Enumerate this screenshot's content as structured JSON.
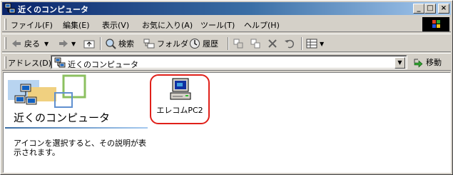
{
  "window": {
    "title": "近くのコンピュータ",
    "icon": "network-neighborhood-icon",
    "controls": {
      "minimize": "_",
      "maximize": "□",
      "close": "×"
    }
  },
  "menubar": {
    "items": [
      {
        "label": "ファイル(F)"
      },
      {
        "label": "編集(E)"
      },
      {
        "label": "表示(V)"
      },
      {
        "label": "お気に入り(A)"
      },
      {
        "label": "ツール(T)"
      },
      {
        "label": "ヘルプ(H)"
      }
    ]
  },
  "toolbar": {
    "back_label": "戻る",
    "search_label": "検索",
    "folders_label": "フォルダ",
    "history_label": "履歴"
  },
  "addressbar": {
    "label": "アドレス(D)",
    "value": "近くのコンピュータ",
    "go_label": "移動"
  },
  "content": {
    "view_title": "近くのコンピュータ",
    "view_description": "アイコンを選択すると、その説明が表示されます。",
    "items": [
      {
        "label": "エレコムPC2",
        "icon": "computer-icon",
        "highlighted": true
      }
    ]
  },
  "colors": {
    "titlebar_start": "#0a246a",
    "titlebar_end": "#a6caf0",
    "face": "#d4d0c8",
    "highlight_ring": "#e0201a"
  }
}
